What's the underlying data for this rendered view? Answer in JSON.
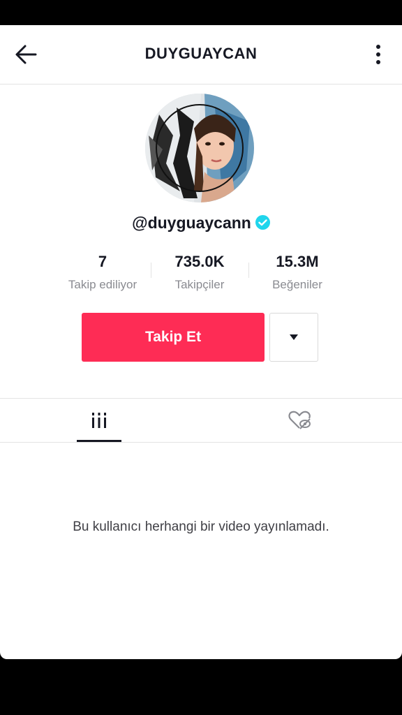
{
  "header": {
    "title": "DUYGUAYCAN",
    "back_icon": "arrow-left-icon",
    "more_icon": "more-vertical-icon"
  },
  "profile": {
    "handle": "@duyguaycann",
    "verified_icon": "verified-badge-icon",
    "verified_color": "#20d5ec"
  },
  "stats": [
    {
      "value": "7",
      "label": "Takip ediliyor"
    },
    {
      "value": "735.0K",
      "label": "Takipçiler"
    },
    {
      "value": "15.3M",
      "label": "Beğeniler"
    }
  ],
  "actions": {
    "follow_label": "Takip Et",
    "follow_color": "#fe2c55",
    "dropdown_icon": "caret-down-icon"
  },
  "tabs": [
    {
      "icon": "video-grid-icon",
      "active": true
    },
    {
      "icon": "liked-hidden-heart-icon",
      "active": false
    }
  ],
  "content": {
    "empty_message": "Bu kullanıcı herhangi bir video yayınlamadı."
  }
}
